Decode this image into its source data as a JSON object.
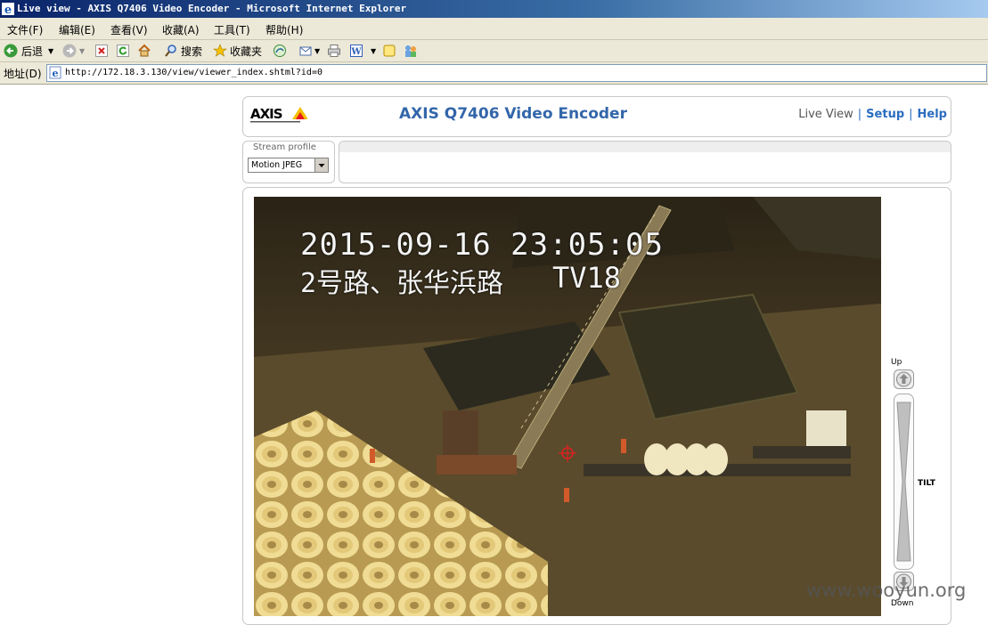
{
  "window": {
    "title": "Live view - AXIS Q7406 Video Encoder - Microsoft Internet Explorer"
  },
  "menu": [
    "文件(F)",
    "编辑(E)",
    "查看(V)",
    "收藏(A)",
    "工具(T)",
    "帮助(H)"
  ],
  "toolbar": {
    "back": "后退",
    "search": "搜索",
    "favorites": "收藏夹"
  },
  "address": {
    "label": "地址(D)",
    "url": "http://172.18.3.130/view/viewer_index.shtml?id=0"
  },
  "page": {
    "title": "AXIS Q7406 Video Encoder",
    "nav": {
      "live_view": "Live View",
      "setup": "Setup",
      "help": "Help",
      "sep": "|"
    },
    "stream_profile": {
      "label": "Stream profile",
      "value": "Motion JPEG"
    }
  },
  "video": {
    "timestamp": "2015-09-16 23:05:05",
    "location": "2号路、张华浜路",
    "channel": "TV18"
  },
  "tilt": {
    "up": "Up",
    "down": "Down",
    "name": "TILT"
  },
  "watermark": "www.wooyun.org",
  "colors": {
    "title_blue": "#3366aa",
    "link_blue": "#2b6dc0",
    "ie_titlebar": "#0a246a"
  }
}
